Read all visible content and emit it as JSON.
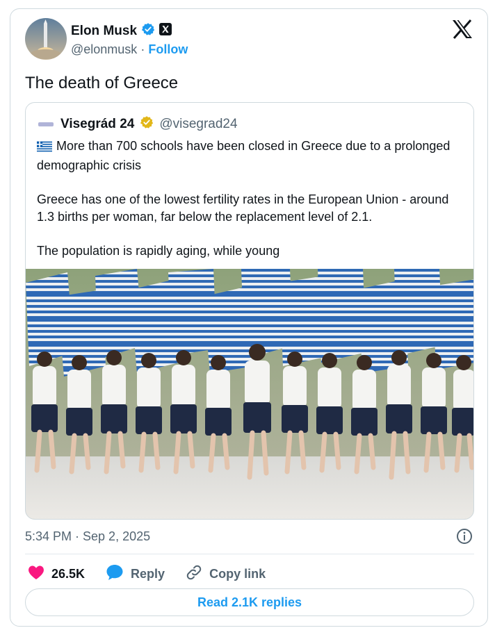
{
  "author": {
    "name": "Elon Musk",
    "handle": "@elonmusk",
    "separator": "·",
    "follow_label": "Follow"
  },
  "tweet": {
    "text": "The death of Greece",
    "timestamp": "5:34 PM · Sep 2, 2025"
  },
  "quote": {
    "name": "Visegrád 24",
    "handle": "@visegrad24",
    "line1": "More than 700 schools have been closed in Greece due to a prolonged demographic crisis",
    "line2": "Greece has one of the lowest fertility rates in the European Union - around 1.3 births per woman, far below the replacement level of 2.1.",
    "line3": "The population is rapidly aging, while young"
  },
  "actions": {
    "likes": "26.5K",
    "reply_label": "Reply",
    "copy_link_label": "Copy link"
  },
  "read_replies_label": "Read 2.1K replies",
  "colors": {
    "accent": "#1d9bf0",
    "like": "#f91880",
    "verified_blue": "#1d9bf0",
    "verified_gold": "#e2b719",
    "border": "#cfd9de",
    "muted": "#536471"
  },
  "icons": [
    "verified-badge-icon",
    "x-logo-icon",
    "greece-flag-icon",
    "info-icon",
    "heart-icon",
    "reply-icon",
    "link-icon"
  ]
}
